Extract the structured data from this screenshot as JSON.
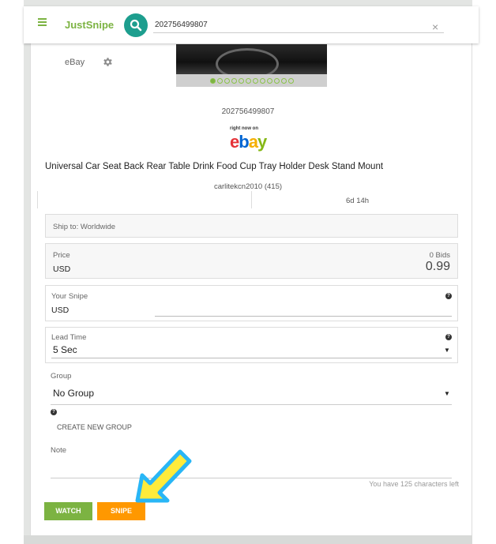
{
  "app": {
    "brand": "JustSnipe"
  },
  "search": {
    "value": "202756499807",
    "clear_symbol": "×"
  },
  "item": {
    "site": "eBay",
    "id": "202756499807",
    "title": "Universal Car Seat Back Rear Table Drink Food Cup Tray Holder Desk Stand Mount",
    "seller": "carlitekcn2010 (415)",
    "time_left": "6d 14h",
    "image_dots": 12
  },
  "ebay_logo": {
    "tagline": "right now on",
    "letters": [
      "e",
      "b",
      "a",
      "y"
    ]
  },
  "ship": {
    "text": "Ship to: Worldwide"
  },
  "price": {
    "label": "Price",
    "currency": "USD",
    "bids": "0 Bids",
    "amount": "0.99"
  },
  "snipe": {
    "label": "Your Snipe",
    "currency": "USD"
  },
  "lead_time": {
    "label": "Lead Time",
    "value": "5 Sec",
    "caret": "▼"
  },
  "group": {
    "label": "Group",
    "value": "No Group",
    "caret": "▼",
    "create_label": "CREATE NEW GROUP"
  },
  "note": {
    "label": "Note",
    "chars_left": "You have 125 characters left"
  },
  "help_symbol": "?",
  "buttons": {
    "watch": "WATCH",
    "snipe": "SNIPE"
  },
  "colors": {
    "accent": "#7cb342",
    "search": "#1d9e8e",
    "snipe": "#ff9800",
    "arrow_fill": "#ffeb3b",
    "arrow_stroke": "#29b6f6"
  }
}
